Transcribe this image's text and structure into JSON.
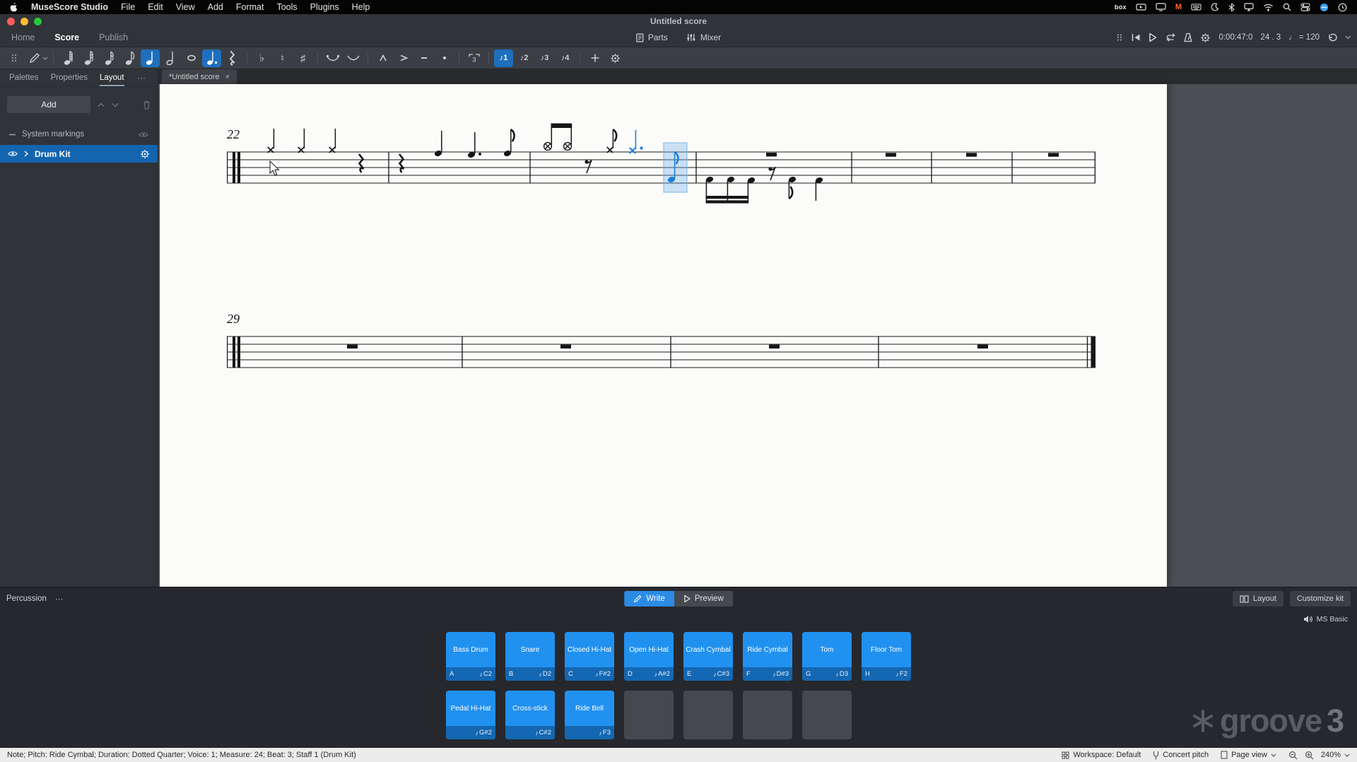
{
  "window": {
    "title": "Untitled score"
  },
  "menu_bar": {
    "items": [
      "MuseScore Studio",
      "File",
      "Edit",
      "View",
      "Add",
      "Format",
      "Tools",
      "Plugins",
      "Help"
    ],
    "box_label": "box",
    "m_label": "M"
  },
  "tab_bar": {
    "tabs": [
      "Home",
      "Score",
      "Publish"
    ],
    "active_tab": "Score",
    "parts_label": "Parts",
    "mixer_label": "Mixer"
  },
  "transport": {
    "time": "0:00:47:0",
    "beat": "24 . 3",
    "tempo": "♩ = 120"
  },
  "toolbar": {
    "flat": "♭",
    "natural": "♮",
    "sharp": "♯",
    "tuplet_label": "3",
    "voice_labels": [
      "♪1",
      "♪2",
      "♪3",
      "♪4"
    ],
    "active_duration": "quarter-dotted",
    "active_voice": "♪1"
  },
  "left_panel": {
    "tabs": [
      "Palettes",
      "Properties",
      "Layout"
    ],
    "active_tab": "Layout",
    "more": "⋯",
    "add_label": "Add",
    "section_label": "System markings",
    "instrument_label": "Drum Kit"
  },
  "document_tab": {
    "label": "*Untitled score",
    "close": "×"
  },
  "score": {
    "measure_numbers": [
      "22",
      "29"
    ]
  },
  "percussion": {
    "panel_title": "Percussion",
    "more": "⋯",
    "write_label": "Write",
    "preview_label": "Preview",
    "layout_label": "Layout",
    "customize_label": "Customize kit",
    "sound_label": "MS Basic",
    "pitch_icon": "♪",
    "pads_row1": [
      {
        "name": "Bass Drum",
        "key": "A",
        "pitch": "C2"
      },
      {
        "name": "Snare",
        "key": "B",
        "pitch": "D2"
      },
      {
        "name": "Closed Hi-Hat",
        "key": "C",
        "pitch": "F#2"
      },
      {
        "name": "Open Hi-Hat",
        "key": "D",
        "pitch": "A#2"
      },
      {
        "name": "Crash Cymbal",
        "key": "E",
        "pitch": "C#3"
      },
      {
        "name": "Ride Cymbal",
        "key": "F",
        "pitch": "D#3"
      },
      {
        "name": "Tom",
        "key": "G",
        "pitch": "D3"
      },
      {
        "name": "Floor Tom",
        "key": "H",
        "pitch": "F2"
      }
    ],
    "pads_row2": [
      {
        "name": "Pedal Hi-Hat",
        "key": "",
        "pitch": "G#2"
      },
      {
        "name": "Cross-stick",
        "key": "",
        "pitch": "C#2"
      },
      {
        "name": "Ride Bell",
        "key": "",
        "pitch": "F3"
      }
    ]
  },
  "watermark": {
    "word": "groove",
    "digit": "3"
  },
  "status_bar": {
    "info": "Note; Pitch: Ride Cymbal; Duration: Dotted Quarter; Voice: 1; Measure: 24; Beat: 3; Staff 1 (Drum Kit)",
    "workspace": "Workspace: Default",
    "concert_pitch": "Concert pitch",
    "view_mode": "Page view",
    "zoom": "240%"
  },
  "colors": {
    "accent": "#1c7fd9",
    "active_button": "#1e6fbe",
    "pad_blue": "#2191f0",
    "pad_footer": "#1467b2",
    "selection_highlight": "#1465af"
  }
}
